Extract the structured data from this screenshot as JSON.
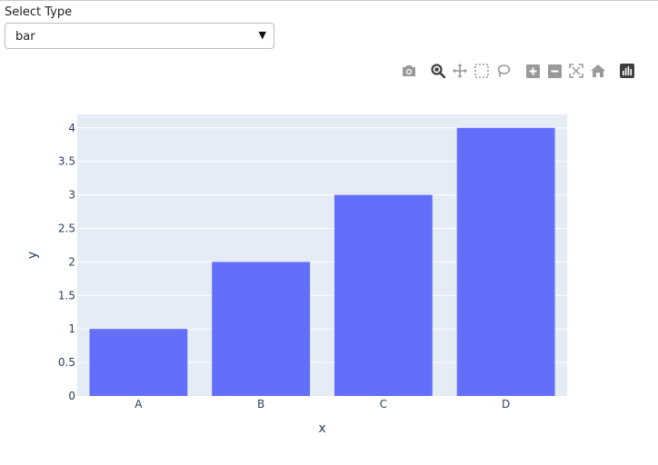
{
  "controls": {
    "select_label": "Select Type",
    "selected_type": "bar",
    "caret": "▼"
  },
  "modebar": {
    "icons": [
      "camera-icon",
      "zoom-icon",
      "pan-icon",
      "box-select-icon",
      "lasso-select-icon",
      "zoom-in-icon",
      "zoom-out-icon",
      "autoscale-icon",
      "reset-axes-icon",
      "plotly-logo-icon"
    ]
  },
  "colors": {
    "plot_bg": "#e5ecf6",
    "bar": "#636efa",
    "grid": "#ffffff",
    "text": "#2a3f5f",
    "icon": "#9a9a9a"
  },
  "chart_data": {
    "type": "bar",
    "categories": [
      "A",
      "B",
      "C",
      "D"
    ],
    "values": [
      1,
      2,
      3,
      4
    ],
    "title": "",
    "xlabel": "x",
    "ylabel": "y",
    "ylim": [
      0,
      4.2
    ],
    "yticks": [
      0,
      0.5,
      1,
      1.5,
      2,
      2.5,
      3,
      3.5,
      4
    ],
    "ytick_labels": [
      "0",
      "0.5",
      "1",
      "1.5",
      "2",
      "2.5",
      "3",
      "3.5",
      "4"
    ],
    "grid": true
  }
}
